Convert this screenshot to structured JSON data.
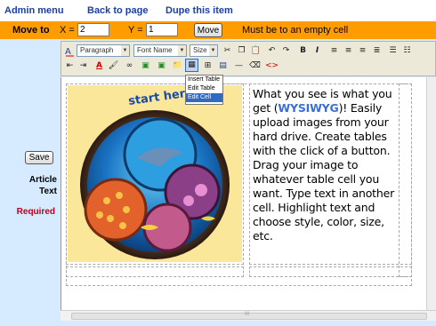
{
  "nav": {
    "admin_menu": "Admin menu",
    "back_to_page": "Back to page",
    "dupe_item": "Dupe this item"
  },
  "move": {
    "label": "Move to",
    "x_label": "X =",
    "x_value": "2",
    "y_label": "Y =",
    "y_value": "1",
    "button": "Move",
    "note": "Must be to an empty cell"
  },
  "sidebar": {
    "save_button": "Save",
    "article_label_1": "Article",
    "article_label_2": "Text",
    "required_label": "Required"
  },
  "toolbar": {
    "paragraph_select": "Paragraph",
    "font_select": "Font Name",
    "size_select": "Size",
    "icons": [
      "spellcheck-icon",
      "cut-icon",
      "copy-icon",
      "paste-icon",
      "undo-icon",
      "redo-icon",
      "bold-icon",
      "italic-icon",
      "align-left-icon",
      "align-center-icon",
      "align-right-icon",
      "justify-icon",
      "ordered-list-icon",
      "unordered-list-icon",
      "outdent-icon",
      "indent-icon",
      "font-color-icon",
      "highlight-icon",
      "link-icon",
      "image-icon",
      "table-icon",
      "hr-icon",
      "eraser-icon",
      "source-icon"
    ],
    "bold_glyph": "B",
    "italic_glyph": "I",
    "font_color_glyph": "A"
  },
  "table_menu": {
    "items": [
      "Insert Table",
      "Edit Table",
      "Edit Cell"
    ],
    "highlighted": "Edit Cell"
  },
  "content": {
    "image_caption": "start here",
    "text_before": "What you see is what you get (",
    "wysiwyg": "WYSIWYG",
    "text_after": ")! Easily upload images from your hard drive. Create tables with the click of a button. Drag your image to whatever table cell you want. Type text in another cell. Highlight text and choose style, color, size, etc."
  },
  "scrollbar": {
    "thumb_grip": "III"
  },
  "colors": {
    "accent_orange": "#ff9d00",
    "panel_blue": "#d6ebff",
    "link_blue": "#1a3fa6",
    "required_red": "#c0001a",
    "wysiwyg_blue": "#3a6fd8"
  }
}
